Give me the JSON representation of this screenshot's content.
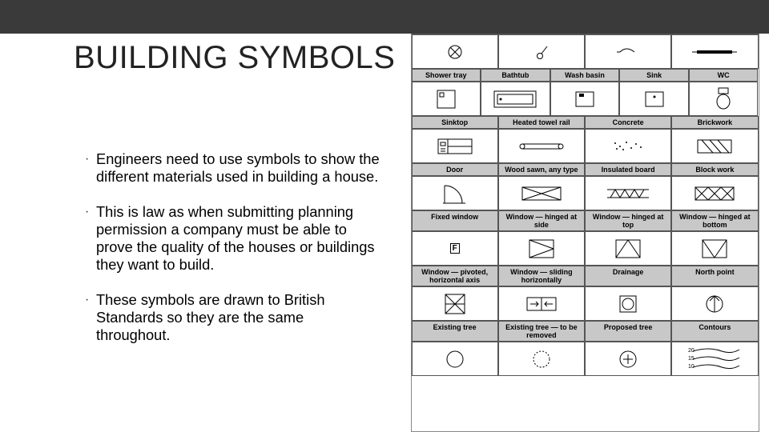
{
  "title": "BUILDING SYMBOLS",
  "bullets": [
    "Engineers need to use symbols to show the different materials used in building a house.",
    "This is law as when submitting planning permission a company must be able to prove the quality of the houses or buildings they want to build.",
    "These symbols are drawn to British Standards so they are the same throughout."
  ],
  "chart": {
    "rows": [
      {
        "cols": 4,
        "labels": [
          "Lamp",
          "Switch",
          "Socket",
          "Radiator"
        ]
      },
      {
        "cols": 5,
        "labels": [
          "Shower tray",
          "Bathtub",
          "Wash basin",
          "Sink",
          "WC"
        ]
      },
      {
        "cols": 4,
        "labels": [
          "Sinktop",
          "Heated towel rail",
          "Concrete",
          "Brickwork"
        ]
      },
      {
        "cols": 4,
        "labels": [
          "Door",
          "Wood sawn, any type",
          "Insulated board",
          "Block work"
        ]
      },
      {
        "cols": 4,
        "labels": [
          "Fixed window",
          "Window — hinged at side",
          "Window — hinged at top",
          "Window — hinged at bottom"
        ]
      },
      {
        "cols": 4,
        "labels": [
          "Window — pivoted, horizontal axis",
          "Window — sliding horizontally",
          "Drainage",
          "North point"
        ]
      },
      {
        "cols": 4,
        "labels": [
          "Existing tree",
          "Existing tree — to be removed",
          "Proposed tree",
          "Contours"
        ]
      }
    ],
    "contour_labels": [
      "20",
      "15",
      "10"
    ]
  }
}
